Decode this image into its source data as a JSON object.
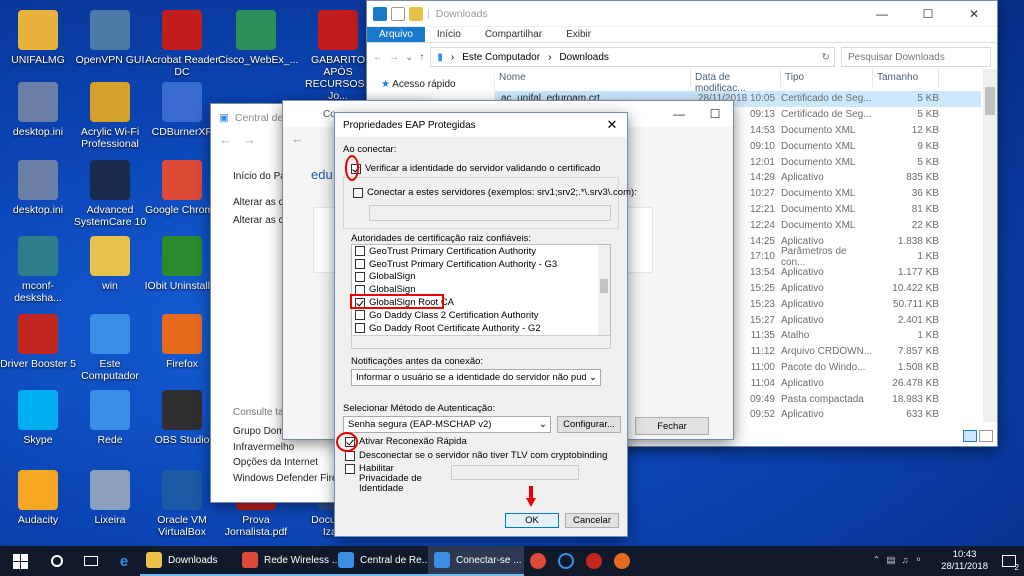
{
  "desktop_icons": [
    {
      "label": "UNIFALMG",
      "icon": "user-folder-icon",
      "color": "#e8b23c"
    },
    {
      "label": "OpenVPN GUI",
      "icon": "openvpn-icon",
      "color": "#4c7aa8"
    },
    {
      "label": "Acrobat Reader DC",
      "icon": "acrobat-icon",
      "color": "#c31d1d"
    },
    {
      "label": "Cisco_WebEx_...",
      "icon": "webex-icon",
      "color": "#2c8f5a"
    },
    {
      "label": "GABARITO APÓS RECURSOS - Jo...",
      "icon": "pdf-icon",
      "color": "#c31d1d"
    },
    {
      "label": "desktop.ini",
      "icon": "file-icon",
      "color": "#6b7fa6"
    },
    {
      "label": "Acrylic Wi-Fi Professional",
      "icon": "acrylic-icon",
      "color": "#d6a12a"
    },
    {
      "label": "CDBurnerXP",
      "icon": "cdburner-icon",
      "color": "#3a6ccf"
    },
    {
      "label": "desktop.ini",
      "icon": "file-icon",
      "color": "#6b7fa6"
    },
    {
      "label": "Advanced SystemCare 10",
      "icon": "systemcare-icon",
      "color": "#1a2a4a"
    },
    {
      "label": "Google Chrome",
      "icon": "chrome-icon",
      "color": "#dd4b39"
    },
    {
      "label": "mconf-desksha...",
      "icon": "mconf-icon",
      "color": "#2e7d8a"
    },
    {
      "label": "win",
      "icon": "folder-icon",
      "color": "#e8c24a"
    },
    {
      "label": "IObit Uninstaller",
      "icon": "uninstaller-icon",
      "color": "#2b8a2b"
    },
    {
      "label": "Driver Booster 5",
      "icon": "driver-booster-icon",
      "color": "#c2271f"
    },
    {
      "label": "Este Computador",
      "icon": "computer-icon",
      "color": "#3a8ee6"
    },
    {
      "label": "Firefox",
      "icon": "firefox-icon",
      "color": "#e66b1f"
    },
    {
      "label": "Skype",
      "icon": "skype-icon",
      "color": "#00aff0"
    },
    {
      "label": "Rede",
      "icon": "network-icon",
      "color": "#3a8ee6"
    },
    {
      "label": "OBS Studio",
      "icon": "obs-icon",
      "color": "#302e31"
    },
    {
      "label": "Audacity",
      "icon": "audacity-icon",
      "color": "#f5a623"
    },
    {
      "label": "Lixeira",
      "icon": "recycle-bin-icon",
      "color": "#8aa0bd"
    },
    {
      "label": "Oracle VM VirtualBox",
      "icon": "virtualbox-icon",
      "color": "#1c5aa6"
    },
    {
      "label": "Prova Jornalista.pdf",
      "icon": "pdf-icon",
      "color": "#c31d1d"
    },
    {
      "label": "Documento Izabell",
      "icon": "word-icon",
      "color": "#2b5797"
    }
  ],
  "explorer": {
    "title": "Downloads",
    "tabs": [
      "Arquivo",
      "Início",
      "Compartilhar",
      "Exibir"
    ],
    "path": [
      "Este Computador",
      "Downloads"
    ],
    "search_placeholder": "Pesquisar Downloads",
    "nav": [
      "Acesso rápido"
    ],
    "columns": [
      "Nome",
      "Data de modificaç...",
      "Tipo",
      "Tamanho"
    ],
    "rows": [
      [
        "ac_unifal_eduroam.crt",
        "28/11/2018 10:05",
        "Certificado de Seg...",
        "5 KB"
      ],
      [
        "",
        "09:13",
        "Certificado de Seg...",
        "5 KB"
      ],
      [
        "",
        "14:53",
        "Documento XML",
        "12 KB"
      ],
      [
        "",
        "09:10",
        "Documento XML",
        "9 KB"
      ],
      [
        "",
        "12:01",
        "Documento XML",
        "5 KB"
      ],
      [
        "",
        "14:29",
        "Aplicativo",
        "835 KB"
      ],
      [
        "",
        "10:27",
        "Documento XML",
        "36 KB"
      ],
      [
        "",
        "12:21",
        "Documento XML",
        "81 KB"
      ],
      [
        "",
        "12:24",
        "Documento XML",
        "22 KB"
      ],
      [
        "",
        "14:25",
        "Aplicativo",
        "1.838 KB"
      ],
      [
        "",
        "17:10",
        "Parâmetros de con...",
        "1 KB"
      ],
      [
        "",
        "13:54",
        "Aplicativo",
        "1.177 KB"
      ],
      [
        "",
        "15:25",
        "Aplicativo",
        "10.422 KB"
      ],
      [
        "",
        "15:23",
        "Aplicativo",
        "50.711 KB"
      ],
      [
        "",
        "15:27",
        "Aplicativo",
        "2.401 KB"
      ],
      [
        "",
        "11:35",
        "Atalho",
        "1 KB"
      ],
      [
        "",
        "11:12",
        "Arquivo CRDOWN...",
        "7.857 KB"
      ],
      [
        "",
        "11:00",
        "Pacote do Windo...",
        "1.508 KB"
      ],
      [
        "",
        "11:04",
        "Aplicativo",
        "26.478 KB"
      ],
      [
        "",
        "09:49",
        "Pasta compactada",
        "18.983 KB"
      ],
      [
        "",
        "09:52",
        "Aplicativo",
        "633 KB"
      ]
    ]
  },
  "central": {
    "title": "Central de Rede",
    "items": [
      "Início do Pai",
      "Alterar as co adaptador",
      "Alterar as co compartilhar"
    ],
    "see_also": "Consulte tam",
    "links": [
      "Grupo Domé",
      "Infravermelho",
      "Opções da Internet",
      "Windows Defender Firew"
    ]
  },
  "conn": {
    "title": "Co",
    "edu": "edu",
    "close_label": "Fechar"
  },
  "dialog": {
    "title": "Propriedades EAP Protegidas",
    "ao_conectar": "Ao conectar:",
    "verify_cert": "Verificar a identidade do servidor validando o certificado",
    "connect_servers": "Conectar a estes servidores (exemplos: srv1;srv2;.*\\.srv3\\.com):",
    "root_ca_label": "Autoridades de certificação raiz confiáveis:",
    "cas": [
      {
        "name": "GeoTrust Primary Certification Authority",
        "checked": false
      },
      {
        "name": "GeoTrust Primary Certification Authority - G3",
        "checked": false
      },
      {
        "name": "GlobalSign",
        "checked": false
      },
      {
        "name": "GlobalSign",
        "checked": false
      },
      {
        "name": "GlobalSign Root CA",
        "checked": true
      },
      {
        "name": "Go Daddy Class 2 Certification Authority",
        "checked": false
      },
      {
        "name": "Go Daddy Root Certificate Authority - G2",
        "checked": false
      }
    ],
    "notif_label": "Notificações antes da conexão:",
    "notif_value": "Informar o usuário se a identidade do servidor não puder ser ver",
    "auth_label": "Selecionar Método de Autenticação:",
    "auth_value": "Senha segura (EAP-MSCHAP v2)",
    "configure": "Configurar...",
    "fast_reconnect": "Ativar Reconexão Rápida",
    "disconnect_tlv": "Desconectar se o servidor não tiver TLV com cryptobinding",
    "privacy": "Habilitar Privacidade de Identidade",
    "ok": "OK",
    "cancel": "Cancelar"
  },
  "taskbar": {
    "apps": [
      {
        "label": "Downloads",
        "color": "#e8c24a"
      },
      {
        "label": "Rede Wireless ...",
        "color": "#dd4b39"
      },
      {
        "label": "Central de Re...",
        "color": "#3a8ee6"
      },
      {
        "label": "Conectar-se ...",
        "color": "#3a8ee6"
      }
    ],
    "time": "10:43",
    "date": "28/11/2018",
    "notifications": "2"
  }
}
